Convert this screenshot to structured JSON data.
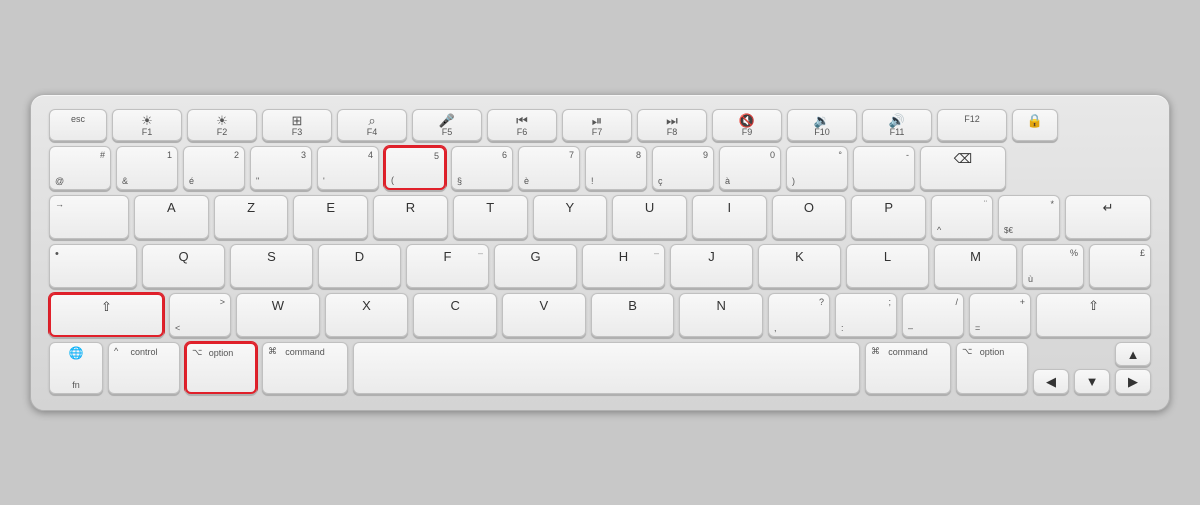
{
  "keyboard": {
    "rows": {
      "frow": [
        {
          "id": "esc",
          "label": "esc",
          "width": "esc"
        },
        {
          "id": "f1",
          "top": "☀",
          "sub": "F1",
          "width": "f"
        },
        {
          "id": "f2",
          "top": "☀",
          "sub": "F2",
          "width": "f"
        },
        {
          "id": "f3",
          "top": "⊞",
          "sub": "F3",
          "width": "f"
        },
        {
          "id": "f4",
          "top": "🔍",
          "sub": "F4",
          "width": "f"
        },
        {
          "id": "f5",
          "top": "🎤",
          "sub": "F5",
          "width": "f"
        },
        {
          "id": "f6",
          "top": "◁◁",
          "sub": "F6",
          "width": "f"
        },
        {
          "id": "f7",
          "top": "▷❙❙",
          "sub": "F7",
          "width": "f"
        },
        {
          "id": "f8",
          "top": "▷▷",
          "sub": "F8",
          "width": "f"
        },
        {
          "id": "f9",
          "top": "🔇",
          "sub": "F9",
          "width": "f"
        },
        {
          "id": "f10",
          "top": "🔉",
          "sub": "F10",
          "width": "f"
        },
        {
          "id": "f11",
          "top": "🔊",
          "sub": "F11",
          "width": "f"
        },
        {
          "id": "f12",
          "top": "",
          "sub": "F12",
          "width": "f"
        },
        {
          "id": "lock",
          "label": "🔒",
          "width": "lock"
        }
      ],
      "row1": [
        {
          "id": "at",
          "top": "#",
          "bot": "@",
          "width": "num"
        },
        {
          "id": "1",
          "top": "1",
          "bot": "&",
          "width": "num"
        },
        {
          "id": "2",
          "top": "2",
          "bot": "é",
          "width": "num"
        },
        {
          "id": "3",
          "top": "3",
          "bot": "\"",
          "width": "num"
        },
        {
          "id": "4",
          "top": "4",
          "bot": "'",
          "width": "num"
        },
        {
          "id": "5",
          "top": "5",
          "bot": "(",
          "width": "num",
          "highlight": true
        },
        {
          "id": "6",
          "top": "6",
          "bot": "§",
          "width": "num"
        },
        {
          "id": "7",
          "top": "7",
          "bot": "è",
          "width": "num"
        },
        {
          "id": "8",
          "top": "8",
          "bot": "!",
          "width": "num"
        },
        {
          "id": "9",
          "top": "9",
          "bot": "ç",
          "width": "num"
        },
        {
          "id": "0",
          "top": "0",
          "bot": "à",
          "width": "num"
        },
        {
          "id": "deg",
          "top": "°",
          "bot": ")",
          "width": "num"
        },
        {
          "id": "minus",
          "top": "-",
          "bot": "",
          "width": "num"
        },
        {
          "id": "backspace",
          "label": "⌫",
          "width": "backspace"
        }
      ],
      "row2": [
        {
          "id": "tab",
          "label": "⇥",
          "width": "tab"
        },
        {
          "id": "a",
          "label": "A",
          "width": "std"
        },
        {
          "id": "z",
          "label": "Z",
          "width": "std"
        },
        {
          "id": "e",
          "label": "E",
          "width": "std"
        },
        {
          "id": "r",
          "label": "R",
          "width": "std"
        },
        {
          "id": "t",
          "label": "T",
          "width": "std"
        },
        {
          "id": "y",
          "label": "Y",
          "width": "std"
        },
        {
          "id": "u",
          "label": "U",
          "width": "std"
        },
        {
          "id": "i",
          "label": "I",
          "width": "std"
        },
        {
          "id": "o",
          "label": "O",
          "width": "std"
        },
        {
          "id": "p",
          "label": "P",
          "width": "std"
        },
        {
          "id": "caret",
          "top": "¨",
          "bot": "^",
          "width": "num"
        },
        {
          "id": "dollar",
          "top": "*",
          "bot": "$€",
          "width": "num"
        },
        {
          "id": "enter",
          "label": "↵",
          "width": "enter"
        }
      ],
      "row3": [
        {
          "id": "caps",
          "top": "•",
          "bot": "",
          "width": "caps"
        },
        {
          "id": "q",
          "label": "Q",
          "width": "std"
        },
        {
          "id": "s",
          "label": "S",
          "width": "std"
        },
        {
          "id": "d",
          "label": "D",
          "width": "std"
        },
        {
          "id": "f",
          "label": "F",
          "top": "–",
          "width": "std"
        },
        {
          "id": "g",
          "label": "G",
          "width": "std"
        },
        {
          "id": "h",
          "label": "H",
          "top": "–",
          "width": "std"
        },
        {
          "id": "j",
          "label": "J",
          "width": "std"
        },
        {
          "id": "k",
          "label": "K",
          "width": "std"
        },
        {
          "id": "l",
          "label": "L",
          "width": "std"
        },
        {
          "id": "m",
          "label": "M",
          "width": "std"
        },
        {
          "id": "pct",
          "top": "%",
          "bot": "ù",
          "width": "num"
        },
        {
          "id": "gbp",
          "top": "£",
          "bot": "",
          "width": "num"
        },
        {
          "id": "enter2",
          "label": "",
          "width": "enter"
        }
      ],
      "row4": [
        {
          "id": "shift-l",
          "label": "⇧",
          "width": "shift-l",
          "highlight": true
        },
        {
          "id": "lt",
          "top": ">",
          "bot": "<",
          "width": "num"
        },
        {
          "id": "w",
          "label": "W",
          "width": "std"
        },
        {
          "id": "x",
          "label": "X",
          "width": "std"
        },
        {
          "id": "c",
          "label": "C",
          "width": "std"
        },
        {
          "id": "v",
          "label": "V",
          "width": "std"
        },
        {
          "id": "b",
          "label": "B",
          "width": "std"
        },
        {
          "id": "n",
          "label": "N",
          "width": "std"
        },
        {
          "id": "comma",
          "top": "?",
          "bot": ",",
          "width": "num"
        },
        {
          "id": "semi",
          "top": ";",
          "bot": ":",
          "width": "num"
        },
        {
          "id": "slash",
          "top": "/",
          "bot": "–",
          "width": "num"
        },
        {
          "id": "equals",
          "top": "+",
          "bot": "=",
          "width": "num"
        },
        {
          "id": "shift-r",
          "label": "⇧",
          "width": "shift-r"
        }
      ],
      "row5": [
        {
          "id": "fn",
          "top": "",
          "bot": "fn",
          "icon": "🌐",
          "width": "fn-bottom"
        },
        {
          "id": "control",
          "label": "control",
          "top": "^",
          "width": "control"
        },
        {
          "id": "option-l",
          "label": "option",
          "top": "⌥",
          "width": "option",
          "highlight": true
        },
        {
          "id": "command-l",
          "label": "command",
          "top": "⌘",
          "width": "command"
        },
        {
          "id": "space",
          "label": "",
          "width": "space"
        },
        {
          "id": "command-r",
          "label": "command",
          "top": "⌘",
          "width": "command-r"
        },
        {
          "id": "option-r",
          "label": "option",
          "top": "⌥",
          "width": "option-r"
        },
        {
          "id": "arr",
          "width": "arrows"
        }
      ]
    }
  }
}
